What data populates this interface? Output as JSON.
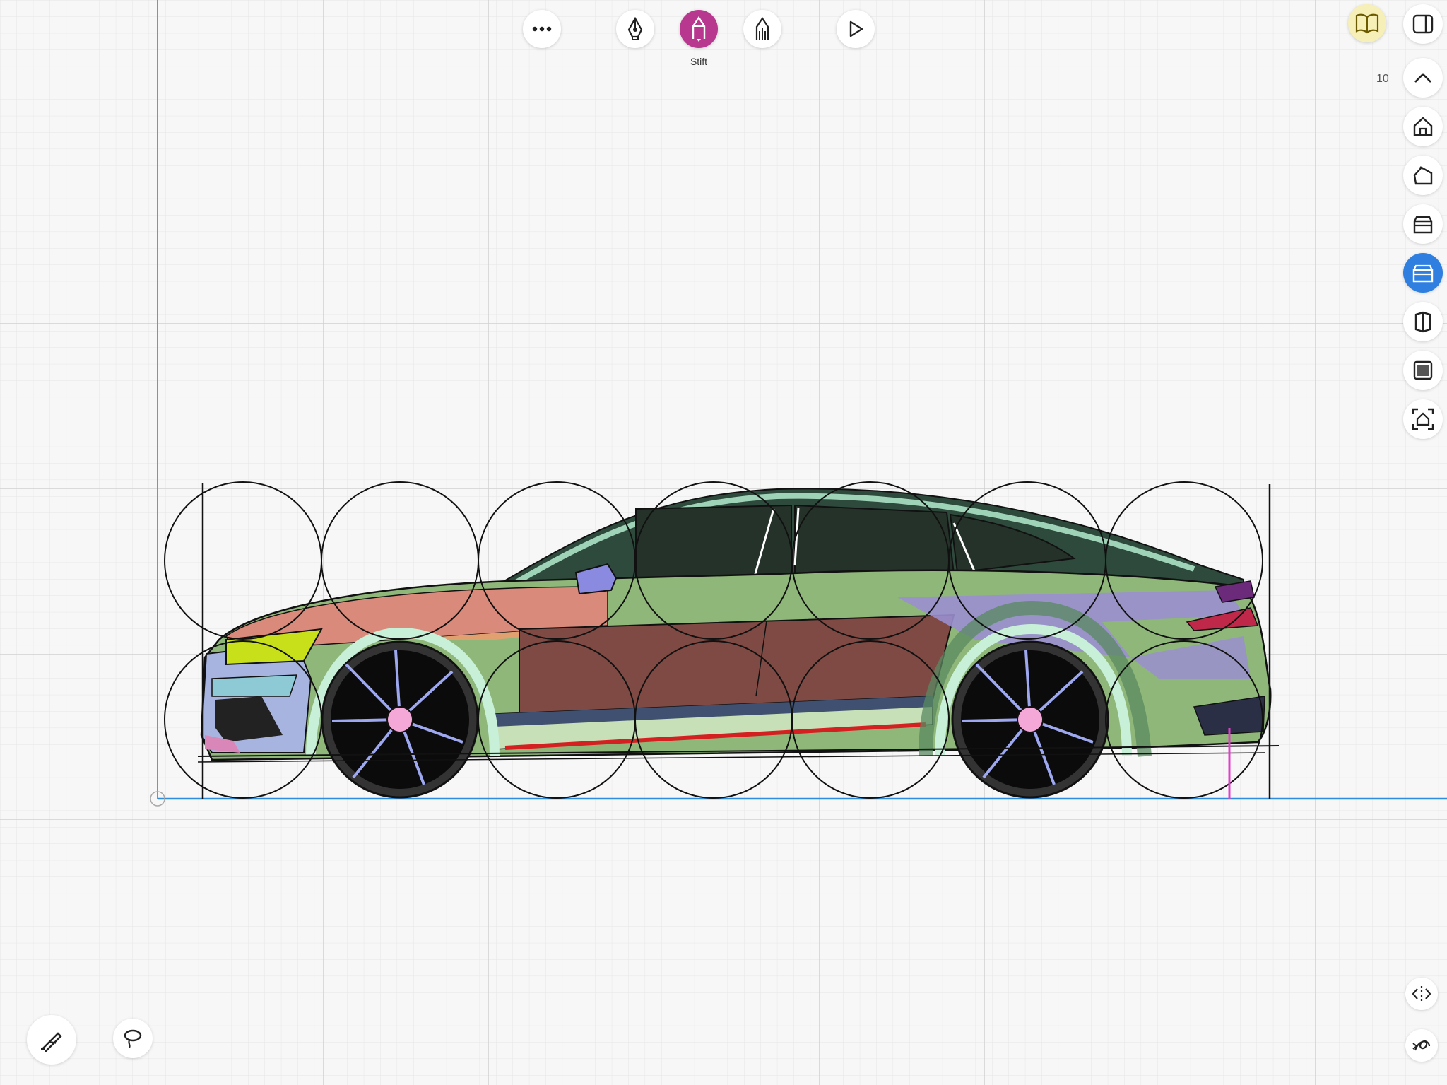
{
  "toolbar": {
    "more_icon": "more-icon",
    "pen_icon": "fountain-pen-icon",
    "pencil_icon": "pencil-icon",
    "marker_icon": "marker-icon",
    "play_icon": "play-icon",
    "active_tool_label": "Stift"
  },
  "zoom": {
    "value": "10"
  },
  "colors": {
    "grid_minor": "#e4e4e4",
    "grid_major": "#cfcfcf",
    "axis_vertical": "#3bbf7a",
    "axis_horizontal": "#2f8de0",
    "active_tool": "#b8378f",
    "selected_view": "#2f7fe0",
    "book_bg": "#f6efb8",
    "guide_pink": "#e040c8"
  },
  "sidebar": {
    "items": [
      {
        "icon": "book-icon"
      },
      {
        "icon": "sidebar-panel-icon"
      },
      {
        "icon": "chevron-up-icon"
      },
      {
        "icon": "home-front-icon"
      },
      {
        "icon": "home-perspective-icon"
      },
      {
        "icon": "box-front-icon"
      },
      {
        "icon": "box-side-icon"
      },
      {
        "icon": "box-half-icon"
      },
      {
        "icon": "cube-icon"
      },
      {
        "icon": "frame-home-icon"
      }
    ]
  },
  "bottom": {
    "left": [
      {
        "icon": "pen-sign-icon"
      },
      {
        "icon": "lasso-icon"
      }
    ],
    "right": [
      {
        "icon": "symmetry-icon"
      },
      {
        "icon": "gesture-icon"
      }
    ]
  }
}
